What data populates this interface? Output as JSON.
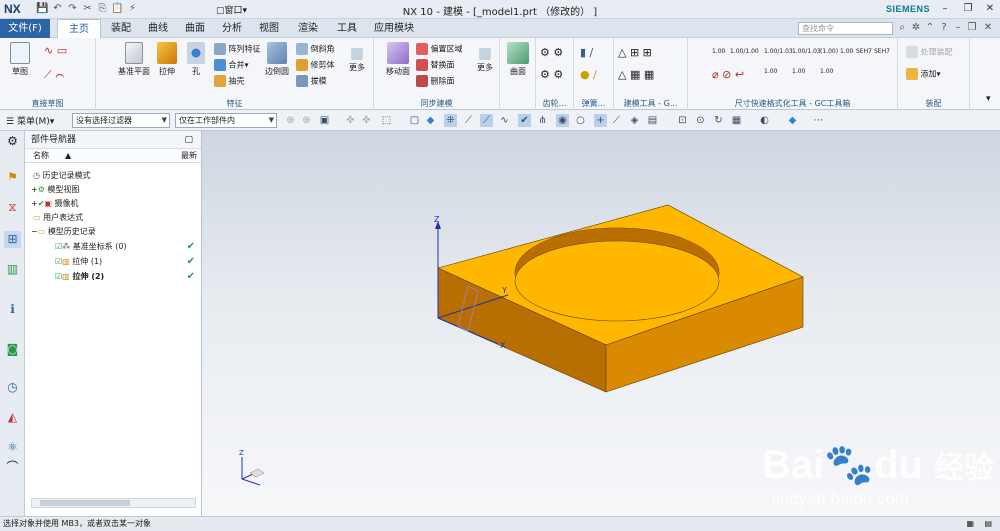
{
  "app": {
    "logo": "NX",
    "title": "NX 10 - 建模 - [_model1.prt （修改的） ]",
    "brand": "SIEMENS",
    "window_menu": "窗口"
  },
  "menubar": {
    "file": "文件(F)",
    "tabs": [
      "主页",
      "装配",
      "曲线",
      "曲面",
      "分析",
      "视图",
      "渲染",
      "工具",
      "应用模块"
    ],
    "active_tab": "主页",
    "search_placeholder": "查找命令"
  },
  "ribbon": {
    "groups": [
      {
        "label": "直接草图",
        "buttons": [
          "草图"
        ]
      },
      {
        "label": "特征",
        "buttons": [
          "基准平面",
          "拉伸",
          "孔",
          "边倒圆",
          "更多"
        ],
        "small": [
          "阵列特征",
          "合并",
          "抽壳",
          "倒斜角",
          "修剪体",
          "拔模"
        ]
      },
      {
        "label": "同步建模",
        "buttons": [
          "移动面",
          "更多"
        ],
        "small": [
          "偏置区域",
          "替换面",
          "删除面"
        ]
      },
      {
        "label": "",
        "buttons": [
          "曲面"
        ]
      },
      {
        "label": "齿轮..."
      },
      {
        "label": "弹簧..."
      },
      {
        "label": "建模工具 - G..."
      },
      {
        "label": "尺寸快速格式化工具 - GC工具箱",
        "small": [
          "1.00",
          "1.00/1.00",
          "1.00/1.03",
          "1.00/1.03",
          "(1.00)",
          "1.00",
          "SEH7",
          "SEH7",
          "1.00",
          "1.00",
          "1.00"
        ]
      },
      {
        "label": "装配",
        "small": [
          "处理装配",
          "添加"
        ]
      }
    ]
  },
  "toolbar2": {
    "menu": "菜单(M)",
    "filter": "没有选择过滤器",
    "scope": "仅在工作部件内"
  },
  "navigator": {
    "title": "部件导航器",
    "col_name": "名称",
    "col_latest": "最新",
    "items": [
      {
        "label": "历史记录模式",
        "indent": 0,
        "bold": false,
        "check": false
      },
      {
        "label": "模型视图",
        "indent": 0,
        "bold": false,
        "check": false
      },
      {
        "label": "摄像机",
        "indent": 0,
        "bold": false,
        "check": true
      },
      {
        "label": "用户表达式",
        "indent": 0,
        "bold": false,
        "check": false
      },
      {
        "label": "模型历史记录",
        "indent": 0,
        "bold": false,
        "check": false
      },
      {
        "label": "基准坐标系 (0)",
        "indent": 1,
        "bold": false,
        "check": true,
        "latest": true
      },
      {
        "label": "拉伸 (1)",
        "indent": 1,
        "bold": false,
        "check": true,
        "latest": true
      },
      {
        "label": "拉伸 (2)",
        "indent": 1,
        "bold": true,
        "check": true,
        "latest": true
      }
    ]
  },
  "viewport": {
    "axis_x": "X",
    "axis_y": "Y",
    "axis_z": "Z"
  },
  "status": {
    "text": "选择对象并使用 MB3，或者双击某一对象"
  },
  "watermark": {
    "brand": "Bai",
    "brand2": "du",
    "cn": "经验",
    "url": "jingyan.baidu.com"
  },
  "colors": {
    "part_top": "#ffb700",
    "part_side": "#d98a00",
    "accent": "#2c64a8"
  }
}
